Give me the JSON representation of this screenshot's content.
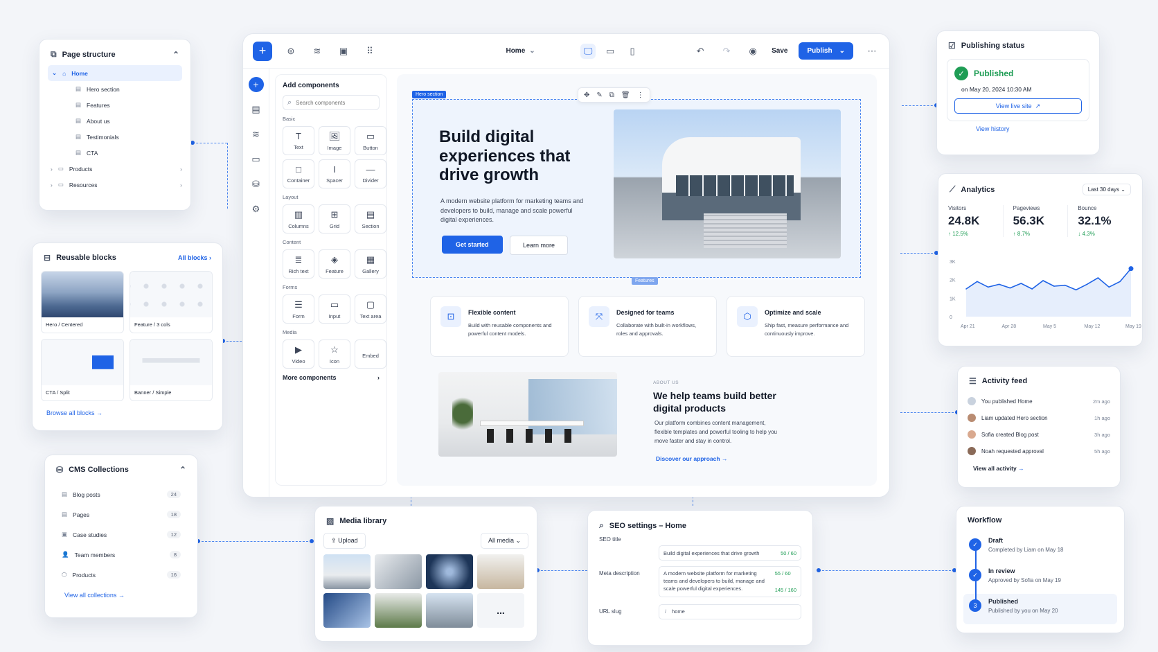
{
  "editor": {
    "page_select": "Home",
    "save": "Save",
    "publish": "Publish",
    "add_components": {
      "title": "Add components",
      "search_placeholder": "Search components",
      "groups": [
        {
          "name": "Basic",
          "items": [
            "Text",
            "Image",
            "Button",
            "Container",
            "Spacer",
            "Divider"
          ]
        },
        {
          "name": "Layout",
          "items": [
            "Columns",
            "Grid",
            "Section"
          ]
        },
        {
          "name": "Content",
          "items": [
            "Rich text",
            "Feature",
            "Gallery"
          ]
        },
        {
          "name": "Forms",
          "items": [
            "Form",
            "Input",
            "Text area"
          ]
        },
        {
          "name": "Media",
          "items": [
            "Video",
            "Icon",
            "Embed"
          ]
        }
      ],
      "more": "More components"
    },
    "hero": {
      "tag": "Hero section",
      "title": "Build digital experiences that drive growth",
      "desc": "A modern website platform for marketing teams and developers to build, manage and scale powerful digital experiences.",
      "cta_primary": "Get started",
      "cta_secondary": "Learn more",
      "features_tag": "Features"
    },
    "features": [
      {
        "title": "Flexible content",
        "desc": "Build with reusable components and powerful content models."
      },
      {
        "title": "Designed for teams",
        "desc": "Collaborate with built-in workflows, roles and approvals."
      },
      {
        "title": "Optimize and scale",
        "desc": "Ship fast, measure performance and continuously improve."
      }
    ],
    "about": {
      "eyebrow": "ABOUT US",
      "title": "We help teams build better digital products",
      "desc": "Our platform combines content management, flexible templates and powerful tooling to help you move faster and stay in control.",
      "link": "Discover our approach"
    }
  },
  "page_structure": {
    "title": "Page structure",
    "root": "Home",
    "children": [
      "Hero section",
      "Features",
      "About us",
      "Testimonials",
      "CTA"
    ],
    "folders": [
      "Products",
      "Resources"
    ]
  },
  "reusable_blocks": {
    "title": "Reusable blocks",
    "all_link": "All blocks",
    "blocks": [
      "Hero / Centered",
      "Feature / 3 cols",
      "CTA / Split",
      "Banner / Simple"
    ],
    "browse": "Browse all blocks"
  },
  "cms": {
    "title": "CMS Collections",
    "items": [
      {
        "name": "Blog posts",
        "count": "24"
      },
      {
        "name": "Pages",
        "count": "18"
      },
      {
        "name": "Case studies",
        "count": "12"
      },
      {
        "name": "Team members",
        "count": "8"
      },
      {
        "name": "Products",
        "count": "16"
      }
    ],
    "view_all": "View all collections"
  },
  "media": {
    "title": "Media library",
    "upload": "Upload",
    "filter": "All media",
    "more": "..."
  },
  "seo": {
    "title": "SEO settings – Home",
    "seo_title_label": "SEO title",
    "seo_title_value": "Build digital experiences that drive growth",
    "seo_title_count": "50 / 60",
    "meta_label": "Meta description",
    "meta_value": "A modern website platform for marketing teams and developers to build, manage and scale powerful digital experiences.",
    "meta_count1": "55 / 60",
    "meta_count2": "145 / 160",
    "slug_label": "URL slug",
    "slug_prefix": "/",
    "slug_value": "home"
  },
  "publishing": {
    "title": "Publishing status",
    "status": "Published",
    "date": "on May 20, 2024 10:30 AM",
    "view_live": "View live site",
    "history": "View history"
  },
  "analytics": {
    "title": "Analytics",
    "range": "Last 30 days",
    "metrics": [
      {
        "label": "Visitors",
        "value": "24.8K",
        "change": "↑ 12.5%",
        "color": "#1f9d55"
      },
      {
        "label": "Pageviews",
        "value": "56.3K",
        "change": "↑ 8.7%",
        "color": "#1f9d55"
      },
      {
        "label": "Bounce",
        "value": "32.1%",
        "change": "↓ 4.3%",
        "color": "#1f9d55"
      }
    ],
    "chart_data": {
      "type": "line",
      "x": [
        "Apr 21",
        "Apr 28",
        "May 5",
        "May 12",
        "May 19"
      ],
      "y_ticks": [
        "3K",
        "2K",
        "1K",
        "0"
      ],
      "ylim": [
        0,
        3000
      ],
      "values": [
        1500,
        1900,
        1600,
        1750,
        1550,
        1800,
        1500,
        1950,
        1650,
        1700,
        1450,
        1750,
        2100,
        1600,
        1900,
        2600
      ]
    }
  },
  "activity": {
    "title": "Activity feed",
    "items": [
      {
        "text": "You published Home",
        "time": "2m ago"
      },
      {
        "text": "Liam updated Hero section",
        "time": "1h ago"
      },
      {
        "text": "Sofia created Blog post",
        "time": "3h ago"
      },
      {
        "text": "Noah requested approval",
        "time": "5h ago"
      }
    ],
    "view_all": "View all activity"
  },
  "workflow": {
    "title": "Workflow",
    "steps": [
      {
        "name": "Draft",
        "sub": "Completed by Liam on May 18",
        "marker": "✓"
      },
      {
        "name": "In review",
        "sub": "Approved by Sofia on May 19",
        "marker": "✓"
      },
      {
        "name": "Published",
        "sub": "Published by you on May 20",
        "marker": "3"
      }
    ]
  }
}
